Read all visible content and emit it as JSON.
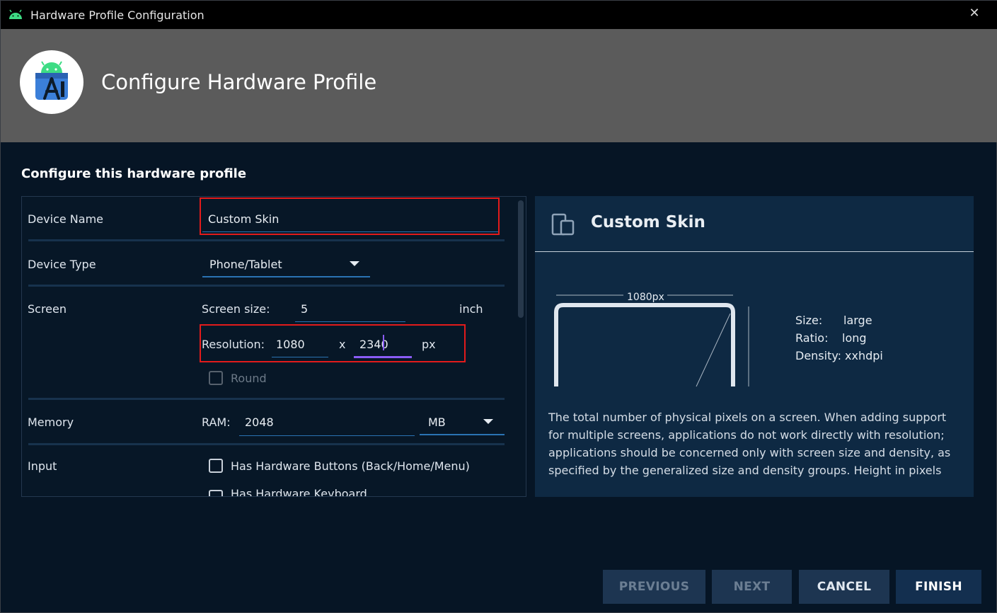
{
  "window": {
    "title": "Hardware Profile Configuration"
  },
  "header": {
    "title": "Configure Hardware Profile"
  },
  "section_title": "Configure this hardware profile",
  "form": {
    "device_name": {
      "label": "Device Name",
      "value": "Custom Skin"
    },
    "device_type": {
      "label": "Device Type",
      "value": "Phone/Tablet"
    },
    "screen": {
      "label": "Screen",
      "size_label": "Screen size:",
      "size_value": "5",
      "size_unit": "inch",
      "resolution_label": "Resolution:",
      "res_width": "1080",
      "res_sep": "x",
      "res_height": "2340",
      "res_unit": "px",
      "round_label": "Round"
    },
    "memory": {
      "label": "Memory",
      "ram_label": "RAM:",
      "ram_value": "2048",
      "ram_unit": "MB"
    },
    "input": {
      "label": "Input",
      "hw_buttons_label": "Has Hardware Buttons (Back/Home/Menu)",
      "hw_keyboard_label": "Has Hardware Keyboard"
    }
  },
  "info": {
    "title": "Custom Skin",
    "diagram_width_label": "1080px",
    "size_label": "Size:",
    "size_value": "large",
    "ratio_label": "Ratio:",
    "ratio_value": "long",
    "density_label": "Density:",
    "density_value": "xxhdpi",
    "description": "The total number of physical pixels on a screen. When adding support for multiple screens, applications do not work directly with resolution; applications should be concerned only with screen size and density, as specified by the generalized size and density groups. Height in pixels"
  },
  "buttons": {
    "previous": "PREVIOUS",
    "next": "NEXT",
    "cancel": "CANCEL",
    "finish": "FINISH"
  },
  "colors": {
    "window_bg": "#061525",
    "header_bg": "#5b5b5b",
    "accent": "#2a73b3",
    "highlight": "#e21b1b",
    "info_bg": "#0e2943"
  }
}
